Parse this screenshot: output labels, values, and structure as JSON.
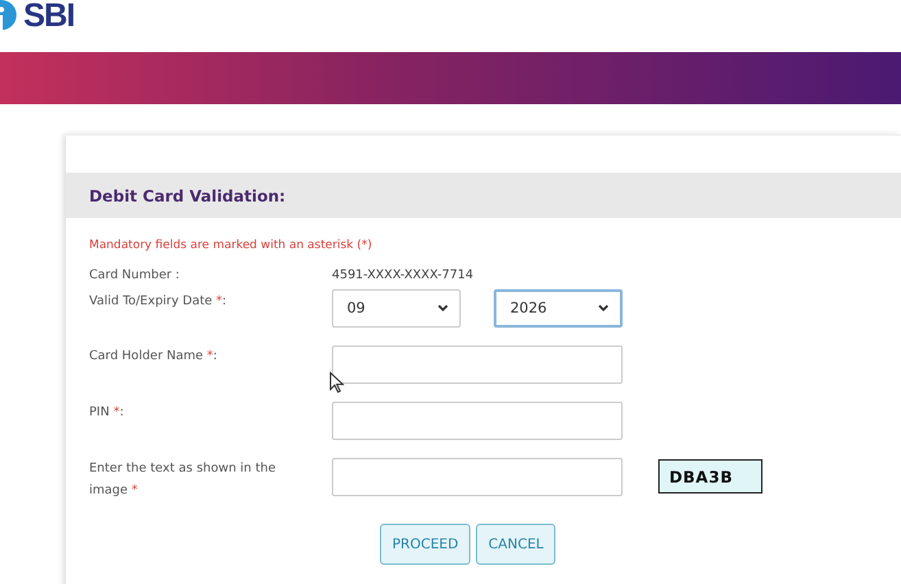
{
  "logo": {
    "text": "SBI"
  },
  "panel": {
    "title": "Debit Card Validation:",
    "note": "Mandatory fields are marked with an asterisk (*)"
  },
  "card_number": {
    "label": "Card Number :",
    "value": "4591-XXXX-XXXX-7714"
  },
  "expiry": {
    "label": "Valid To/Expiry Date ",
    "mark": "*",
    "suffix": ":",
    "month": "09",
    "year": "2026",
    "year_focused": true
  },
  "fields": [
    {
      "label": "Card Holder Name ",
      "mark": "*",
      "suffix": ":"
    },
    {
      "label": "PIN ",
      "mark": "*",
      "suffix": ":"
    },
    {
      "label": "Enter the text as shown in the image ",
      "mark": "*",
      "captcha": "DBA3B"
    }
  ],
  "buttons": [
    "PROCEED",
    "CANCEL"
  ]
}
